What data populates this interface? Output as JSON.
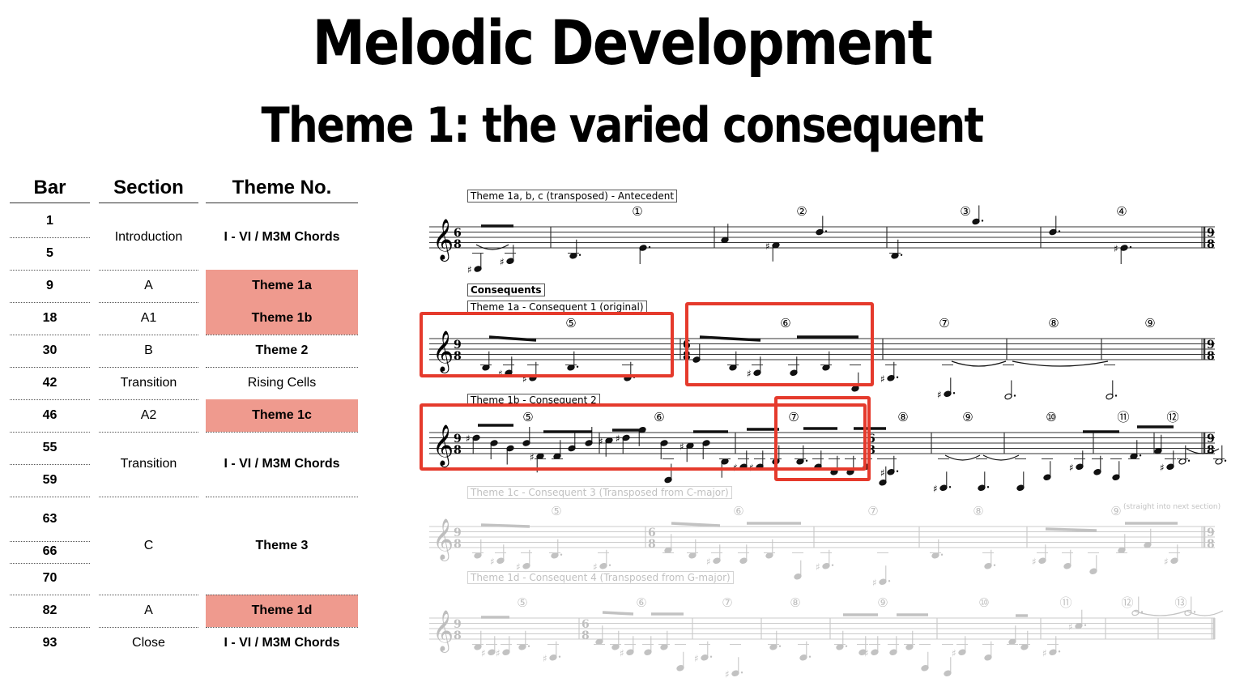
{
  "title": "Melodic Development",
  "subtitle": "Theme 1: the varied consequent",
  "table": {
    "headers": [
      "Bar",
      "Section",
      "Theme No."
    ],
    "bars": [
      "1",
      "5",
      "9",
      "18",
      "30",
      "42",
      "46",
      "55",
      "59",
      "63",
      "66",
      "70",
      "82",
      "93"
    ],
    "sections": [
      "Introduction",
      "A",
      "A1",
      "B",
      "Transition",
      "A2",
      "Transition",
      "C",
      "A",
      "Close"
    ],
    "themes": [
      {
        "label": "I - VI / M3M Chords",
        "highlighted": false,
        "bold": true
      },
      {
        "label": "Theme 1a",
        "highlighted": true,
        "bold": true
      },
      {
        "label": "Theme 1b",
        "highlighted": true,
        "bold": true
      },
      {
        "label": "Theme 2",
        "highlighted": false,
        "bold": true
      },
      {
        "label": "Rising Cells",
        "highlighted": false,
        "bold": false
      },
      {
        "label": "Theme 1c",
        "highlighted": true,
        "bold": true
      },
      {
        "label": "I - VI / M3M Chords",
        "highlighted": false,
        "bold": true
      },
      {
        "label": "Theme 3",
        "highlighted": false,
        "bold": true
      },
      {
        "label": "Theme 1d",
        "highlighted": true,
        "bold": true
      },
      {
        "label": "I - VI / M3M Chords",
        "highlighted": false,
        "bold": true
      }
    ],
    "highlight_color": "#ef9a8e"
  },
  "score": {
    "highlight_box_color": "#e53a2c",
    "systems": [
      {
        "label": "Theme 1a, b, c (transposed) - Antecedent",
        "time_start": "6/8",
        "time_end": "9/8",
        "measure_numbers": [
          "①",
          "②",
          "③",
          "④"
        ],
        "faded": false
      },
      {
        "heading": "Consequents",
        "label": "Theme 1a - Consequent 1 (original)",
        "time_start": "9/8",
        "time_change": "6/8",
        "time_end": "9/8",
        "measure_numbers": [
          "⑤",
          "⑥",
          "⑦",
          "⑧",
          "⑨"
        ],
        "faded": false
      },
      {
        "label": "Theme 1b - Consequent 2",
        "time_start": "9/8",
        "time_change": "6/8",
        "time_end": "9/8",
        "measure_numbers": [
          "⑤",
          "⑥",
          "⑦",
          "⑧",
          "⑨",
          "⑩",
          "⑪",
          "⑫"
        ],
        "faded": false
      },
      {
        "label": "Theme 1c - Consequent 3 (Transposed from C-major)",
        "time_start": "9/8",
        "time_change": "6/8",
        "time_end": "9/8",
        "measure_numbers": [
          "⑤",
          "⑥",
          "⑦",
          "⑧",
          "⑨"
        ],
        "note": "(straight into next section)",
        "faded": true
      },
      {
        "label": "Theme 1d - Consequent 4 (Transposed from G-major)",
        "time_start": "9/8",
        "time_change": "6/8",
        "measure_numbers": [
          "⑤",
          "⑥",
          "⑦",
          "⑧",
          "⑨",
          "⑩",
          "⑪",
          "⑫",
          "⑬"
        ],
        "faded": true
      }
    ]
  }
}
